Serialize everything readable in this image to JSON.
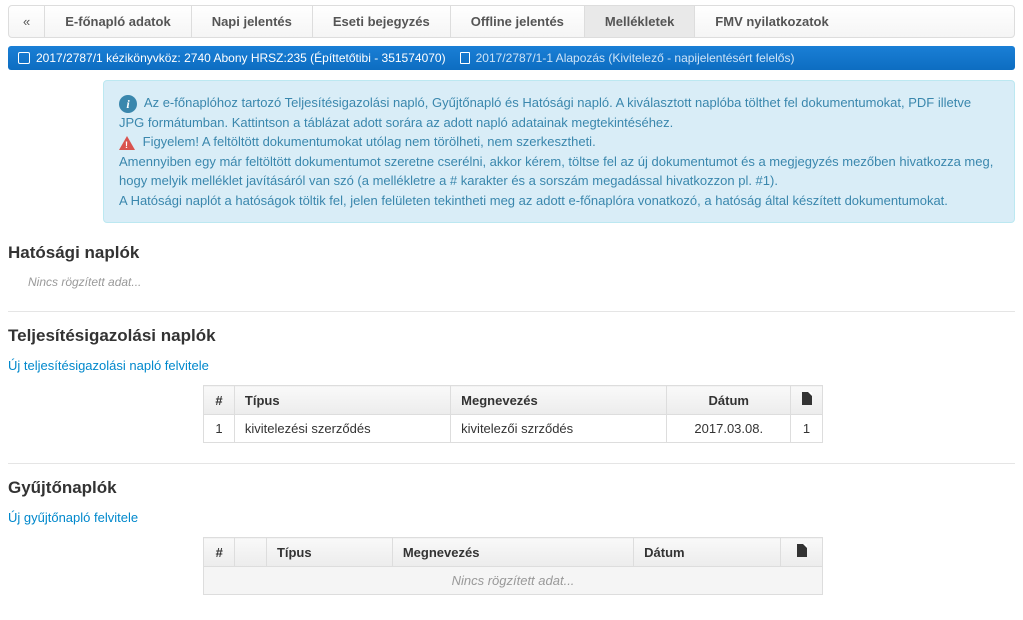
{
  "tabs": {
    "collapse": "«",
    "items": [
      "E-főnapló adatok",
      "Napi jelentés",
      "Eseti bejegyzés",
      "Offline jelentés",
      "Mellékletek",
      "FMV nyilatkozatok"
    ],
    "active_index": 4
  },
  "breadcrumb": {
    "main": "2017/2787/1 kézikönyvköz: 2740 Abony HRSZ:235 (Építtetőtibi - 351574070)",
    "sub": "2017/2787/1-1 Alapozás (Kivitelező - napijelentésért felelős)"
  },
  "info": {
    "line1": "Az e-főnaplóhoz tartozó Teljesítésigazolási napló, Gyűjtőnapló és Hatósági napló. A kiválasztott naplóba tölthet fel dokumentumokat, PDF illetve JPG formátumban. Kattintson a táblázat adott sorára az adott napló adatainak megtekintéséhez.",
    "warn": "Figyelem! A feltöltött dokumentumokat utólag nem törölheti, nem szerkesztheti.",
    "line2": "Amennyiben egy már feltöltött dokumentumot szeretne cserélni, akkor kérem, töltse fel az új dokumentumot és a megjegyzés mezőben hivatkozza meg, hogy melyik melléklet javításáról van szó (a mellékletre a # karakter és a sorszám megadással hivatkozzon pl. #1).",
    "line3": "A Hatósági naplót a hatóságok töltik fel, jelen felületen tekintheti meg az adott e-főnaplóra vonatkozó, a hatóság által készített dokumentumokat."
  },
  "sections": {
    "hatosagi": {
      "title": "Hatósági naplók",
      "empty": "Nincs rögzített adat..."
    },
    "teljesites": {
      "title": "Teljesítésigazolási naplók",
      "add_link": "Új teljesítésigazolási napló felvitele",
      "headers": {
        "num": "#",
        "tipus": "Típus",
        "megnevezes": "Megnevezés",
        "datum": "Dátum"
      },
      "rows": [
        {
          "num": "1",
          "tipus": "kivitelezési szerződés",
          "megnevezes": "kivitelezői szrződés",
          "datum": "2017.03.08.",
          "count": "1"
        }
      ]
    },
    "gyujto": {
      "title": "Gyűjtőnaplók",
      "add_link": "Új gyűjtőnapló felvitele",
      "headers": {
        "num": "#",
        "tipus": "Típus",
        "megnevezes": "Megnevezés",
        "datum": "Dátum"
      },
      "empty": "Nincs rögzített adat..."
    }
  }
}
